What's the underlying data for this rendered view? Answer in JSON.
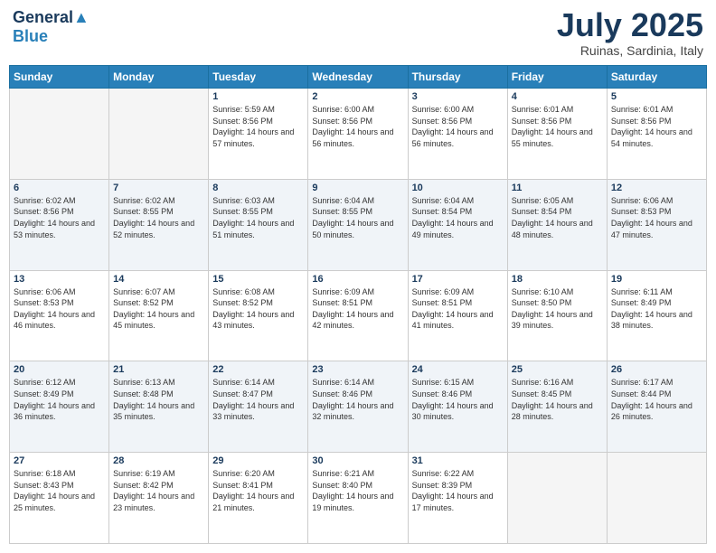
{
  "header": {
    "logo_line1": "General",
    "logo_line2": "Blue",
    "month": "July 2025",
    "location": "Ruinas, Sardinia, Italy"
  },
  "days_of_week": [
    "Sunday",
    "Monday",
    "Tuesday",
    "Wednesday",
    "Thursday",
    "Friday",
    "Saturday"
  ],
  "weeks": [
    [
      {
        "day": "",
        "sunrise": "",
        "sunset": "",
        "daylight": ""
      },
      {
        "day": "",
        "sunrise": "",
        "sunset": "",
        "daylight": ""
      },
      {
        "day": "1",
        "sunrise": "Sunrise: 5:59 AM",
        "sunset": "Sunset: 8:56 PM",
        "daylight": "Daylight: 14 hours and 57 minutes."
      },
      {
        "day": "2",
        "sunrise": "Sunrise: 6:00 AM",
        "sunset": "Sunset: 8:56 PM",
        "daylight": "Daylight: 14 hours and 56 minutes."
      },
      {
        "day": "3",
        "sunrise": "Sunrise: 6:00 AM",
        "sunset": "Sunset: 8:56 PM",
        "daylight": "Daylight: 14 hours and 56 minutes."
      },
      {
        "day": "4",
        "sunrise": "Sunrise: 6:01 AM",
        "sunset": "Sunset: 8:56 PM",
        "daylight": "Daylight: 14 hours and 55 minutes."
      },
      {
        "day": "5",
        "sunrise": "Sunrise: 6:01 AM",
        "sunset": "Sunset: 8:56 PM",
        "daylight": "Daylight: 14 hours and 54 minutes."
      }
    ],
    [
      {
        "day": "6",
        "sunrise": "Sunrise: 6:02 AM",
        "sunset": "Sunset: 8:56 PM",
        "daylight": "Daylight: 14 hours and 53 minutes."
      },
      {
        "day": "7",
        "sunrise": "Sunrise: 6:02 AM",
        "sunset": "Sunset: 8:55 PM",
        "daylight": "Daylight: 14 hours and 52 minutes."
      },
      {
        "day": "8",
        "sunrise": "Sunrise: 6:03 AM",
        "sunset": "Sunset: 8:55 PM",
        "daylight": "Daylight: 14 hours and 51 minutes."
      },
      {
        "day": "9",
        "sunrise": "Sunrise: 6:04 AM",
        "sunset": "Sunset: 8:55 PM",
        "daylight": "Daylight: 14 hours and 50 minutes."
      },
      {
        "day": "10",
        "sunrise": "Sunrise: 6:04 AM",
        "sunset": "Sunset: 8:54 PM",
        "daylight": "Daylight: 14 hours and 49 minutes."
      },
      {
        "day": "11",
        "sunrise": "Sunrise: 6:05 AM",
        "sunset": "Sunset: 8:54 PM",
        "daylight": "Daylight: 14 hours and 48 minutes."
      },
      {
        "day": "12",
        "sunrise": "Sunrise: 6:06 AM",
        "sunset": "Sunset: 8:53 PM",
        "daylight": "Daylight: 14 hours and 47 minutes."
      }
    ],
    [
      {
        "day": "13",
        "sunrise": "Sunrise: 6:06 AM",
        "sunset": "Sunset: 8:53 PM",
        "daylight": "Daylight: 14 hours and 46 minutes."
      },
      {
        "day": "14",
        "sunrise": "Sunrise: 6:07 AM",
        "sunset": "Sunset: 8:52 PM",
        "daylight": "Daylight: 14 hours and 45 minutes."
      },
      {
        "day": "15",
        "sunrise": "Sunrise: 6:08 AM",
        "sunset": "Sunset: 8:52 PM",
        "daylight": "Daylight: 14 hours and 43 minutes."
      },
      {
        "day": "16",
        "sunrise": "Sunrise: 6:09 AM",
        "sunset": "Sunset: 8:51 PM",
        "daylight": "Daylight: 14 hours and 42 minutes."
      },
      {
        "day": "17",
        "sunrise": "Sunrise: 6:09 AM",
        "sunset": "Sunset: 8:51 PM",
        "daylight": "Daylight: 14 hours and 41 minutes."
      },
      {
        "day": "18",
        "sunrise": "Sunrise: 6:10 AM",
        "sunset": "Sunset: 8:50 PM",
        "daylight": "Daylight: 14 hours and 39 minutes."
      },
      {
        "day": "19",
        "sunrise": "Sunrise: 6:11 AM",
        "sunset": "Sunset: 8:49 PM",
        "daylight": "Daylight: 14 hours and 38 minutes."
      }
    ],
    [
      {
        "day": "20",
        "sunrise": "Sunrise: 6:12 AM",
        "sunset": "Sunset: 8:49 PM",
        "daylight": "Daylight: 14 hours and 36 minutes."
      },
      {
        "day": "21",
        "sunrise": "Sunrise: 6:13 AM",
        "sunset": "Sunset: 8:48 PM",
        "daylight": "Daylight: 14 hours and 35 minutes."
      },
      {
        "day": "22",
        "sunrise": "Sunrise: 6:14 AM",
        "sunset": "Sunset: 8:47 PM",
        "daylight": "Daylight: 14 hours and 33 minutes."
      },
      {
        "day": "23",
        "sunrise": "Sunrise: 6:14 AM",
        "sunset": "Sunset: 8:46 PM",
        "daylight": "Daylight: 14 hours and 32 minutes."
      },
      {
        "day": "24",
        "sunrise": "Sunrise: 6:15 AM",
        "sunset": "Sunset: 8:46 PM",
        "daylight": "Daylight: 14 hours and 30 minutes."
      },
      {
        "day": "25",
        "sunrise": "Sunrise: 6:16 AM",
        "sunset": "Sunset: 8:45 PM",
        "daylight": "Daylight: 14 hours and 28 minutes."
      },
      {
        "day": "26",
        "sunrise": "Sunrise: 6:17 AM",
        "sunset": "Sunset: 8:44 PM",
        "daylight": "Daylight: 14 hours and 26 minutes."
      }
    ],
    [
      {
        "day": "27",
        "sunrise": "Sunrise: 6:18 AM",
        "sunset": "Sunset: 8:43 PM",
        "daylight": "Daylight: 14 hours and 25 minutes."
      },
      {
        "day": "28",
        "sunrise": "Sunrise: 6:19 AM",
        "sunset": "Sunset: 8:42 PM",
        "daylight": "Daylight: 14 hours and 23 minutes."
      },
      {
        "day": "29",
        "sunrise": "Sunrise: 6:20 AM",
        "sunset": "Sunset: 8:41 PM",
        "daylight": "Daylight: 14 hours and 21 minutes."
      },
      {
        "day": "30",
        "sunrise": "Sunrise: 6:21 AM",
        "sunset": "Sunset: 8:40 PM",
        "daylight": "Daylight: 14 hours and 19 minutes."
      },
      {
        "day": "31",
        "sunrise": "Sunrise: 6:22 AM",
        "sunset": "Sunset: 8:39 PM",
        "daylight": "Daylight: 14 hours and 17 minutes."
      },
      {
        "day": "",
        "sunrise": "",
        "sunset": "",
        "daylight": ""
      },
      {
        "day": "",
        "sunrise": "",
        "sunset": "",
        "daylight": ""
      }
    ]
  ]
}
